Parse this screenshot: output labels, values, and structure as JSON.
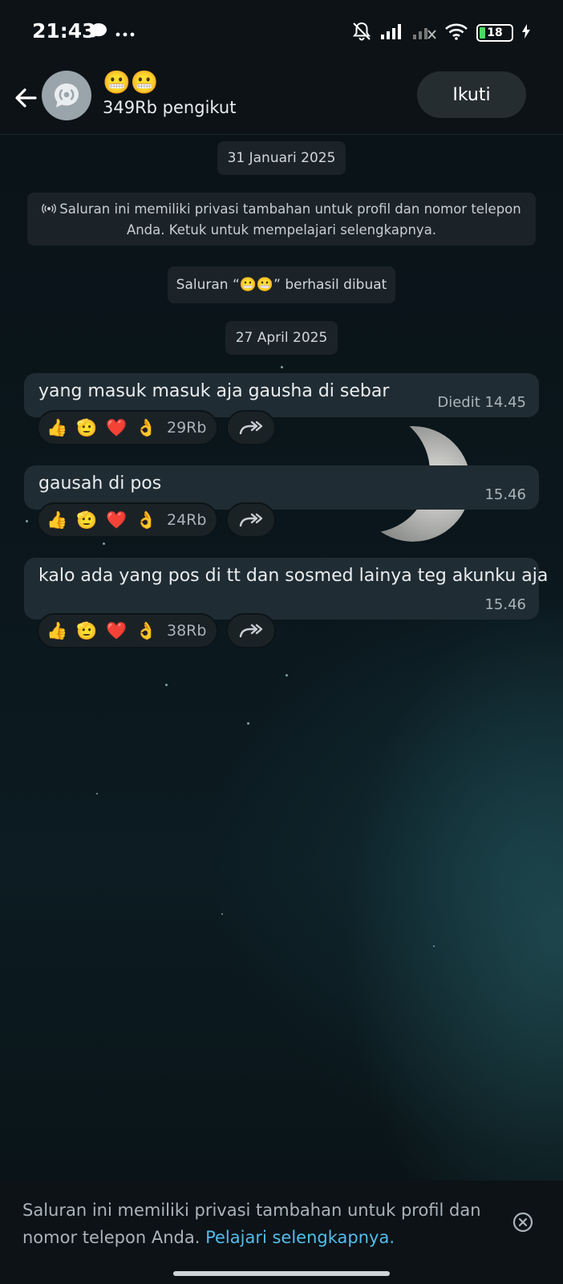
{
  "status_bar": {
    "time": "21:43",
    "battery_level": "18"
  },
  "header": {
    "title": "😬😬",
    "subtitle": "349Rb pengikut",
    "follow_label": "Ikuti"
  },
  "chat": {
    "date_1": "31 Januari 2025",
    "privacy_notice": "Saluran ini memiliki privasi tambahan untuk profil dan nomor telepon Anda. Ketuk untuk mempelajari selengkapnya.",
    "channel_created": "Saluran “😬😬” berhasil dibuat",
    "date_2": "27 April 2025",
    "messages": [
      {
        "text": "yang masuk masuk aja gausha di sebar",
        "time": "Diedit 14.45",
        "reactions": [
          "👍",
          "🫡",
          "❤️",
          "👌"
        ],
        "reaction_count": "29Rb"
      },
      {
        "text": "gausah di pos",
        "time": "15.46",
        "reactions": [
          "👍",
          "🫡",
          "❤️",
          "👌"
        ],
        "reaction_count": "24Rb"
      },
      {
        "text": "kalo ada yang pos di tt dan sosmed lainya teg akunku aja",
        "time": "15.46",
        "reactions": [
          "👍",
          "🫡",
          "❤️",
          "👌"
        ],
        "reaction_count": "38Rb"
      }
    ]
  },
  "bottom_banner": {
    "text": "Saluran ini memiliki privasi tambahan untuk profil dan nomor telepon Anda.",
    "link": "Pelajari selengkapnya."
  },
  "colors": {
    "accent_link": "#53bdeb",
    "bubble": "#202c33",
    "header_bg": "#0c1216"
  },
  "icons": [
    "back-arrow-icon",
    "channel-avatar-icon",
    "forward-icon",
    "close-circle-icon",
    "muted-bell-icon",
    "wifi-icon",
    "signal-icon",
    "battery-icon",
    "chat-bubble-icon",
    "more-dots-icon",
    "broadcast-icon"
  ]
}
